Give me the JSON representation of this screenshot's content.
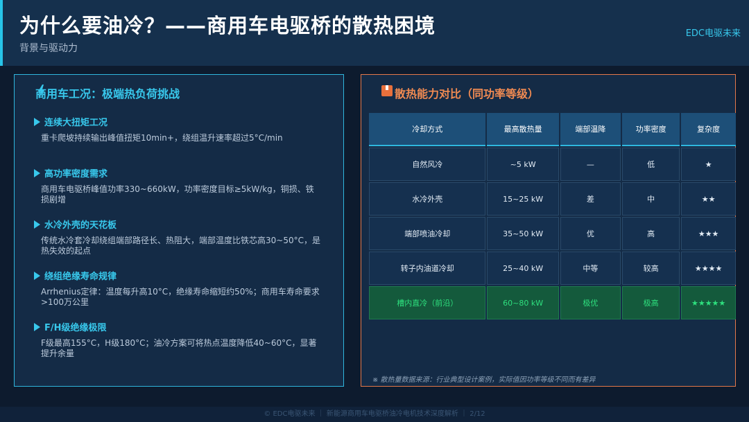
{
  "header": {
    "title": "为什么要油冷？——商用车电驱桥的散热困境",
    "subtitle": "背景与驱动力",
    "brand": "EDC电驱未来"
  },
  "left_panel": {
    "title": "商用车工况：极端热负荷挑战",
    "icon": "lightning-bolt-icon",
    "items": [
      {
        "head": "连续大扭矩工况",
        "desc": "重卡爬坡持续输出峰值扭矩10min+，绕组温升速率超过5°C/min"
      },
      {
        "head": "高功率密度需求",
        "desc": "商用车电驱桥峰值功率330~660kW，功率密度目标≥5kW/kg，铜损、铁损剧增"
      },
      {
        "head": "水冷外壳的天花板",
        "desc": "传统水冷套冷却绕组端部路径长、热阻大，端部温度比铁芯高30~50°C，是热失效的起点"
      },
      {
        "head": "绕组绝缘寿命规律",
        "desc": "Arrhenius定律：温度每升高10°C，绝缘寿命缩短约50%；商用车寿命要求>100万公里"
      },
      {
        "head": "F/H级绝缘极限",
        "desc": "F级最高155°C，H级180°C；油冷方案可将热点温度降低40~60°C，显著提升余量"
      }
    ]
  },
  "right_panel": {
    "title": "散热能力对比（同功率等级）",
    "icon": "toolbox-icon",
    "table": {
      "headers": [
        "冷却方式",
        "最高散热量",
        "端部温降",
        "功率密度",
        "复杂度"
      ],
      "rows": [
        [
          "自然风冷",
          "~5 kW",
          "—",
          "低",
          "★"
        ],
        [
          "水冷外壳",
          "15~25 kW",
          "差",
          "中",
          "★★"
        ],
        [
          "端部喷油冷却",
          "35~50 kW",
          "优",
          "高",
          "★★★"
        ],
        [
          "转子内油道冷却",
          "25~40 kW",
          "中等",
          "较高",
          "★★★★"
        ],
        [
          "槽内直冷（前沿）",
          "60~80 kW",
          "极优",
          "极高",
          "★★★★★"
        ]
      ]
    },
    "footnote": "※ 散热量数据来源：行业典型设计案例，实际值因功率等级不同而有差异"
  },
  "footer": {
    "text": "© EDC电驱未来 ｜ 新能源商用车电驱桥油冷电机技术深度解析 ｜ 2/12"
  },
  "colors": {
    "accent_cyan": "#38c8ec",
    "accent_orange": "#f08a52",
    "highlight_green": "#2ee07e"
  }
}
